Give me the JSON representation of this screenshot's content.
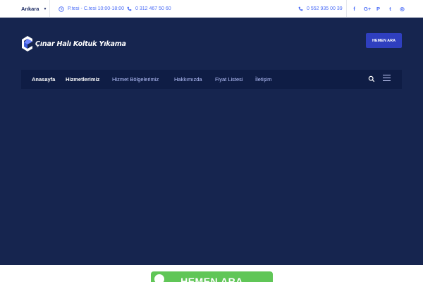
{
  "topbar": {
    "city": "Ankara",
    "hours": "P.tesi - C.tesi 10:00-18:00",
    "phone_landline": "0 312 467 50 60",
    "phone_mobile": "0 552 935 00 39",
    "social": {
      "facebook": "f",
      "google_plus": "G+",
      "pinterest": "P",
      "twitter": "t",
      "instagram": "◎"
    }
  },
  "header": {
    "logo_text": "Çınar Halı Koltuk Yıkama",
    "cta_label": "HEMEN ARA"
  },
  "nav": {
    "items": [
      {
        "label": "Anasayfa"
      },
      {
        "label": "Hizmetlerimiz"
      },
      {
        "label": "Hizmet Bölgelerimiz"
      },
      {
        "label": "Hakkımızda"
      },
      {
        "label": "Fiyat Listesi"
      },
      {
        "label": "İletişim"
      }
    ]
  },
  "bottom": {
    "call_label": "HEMEN ARA"
  },
  "colors": {
    "hero_bg": "#16254f",
    "nav_bg": "#0f1d45",
    "accent": "#2f3fbf",
    "link": "#4a6cf7",
    "call_green": "#60c657"
  },
  "icons": [
    "clock-icon",
    "phone-icon",
    "facebook-icon",
    "google-plus-icon",
    "pinterest-icon",
    "twitter-icon",
    "instagram-icon",
    "search-icon",
    "hamburger-menu-icon"
  ]
}
